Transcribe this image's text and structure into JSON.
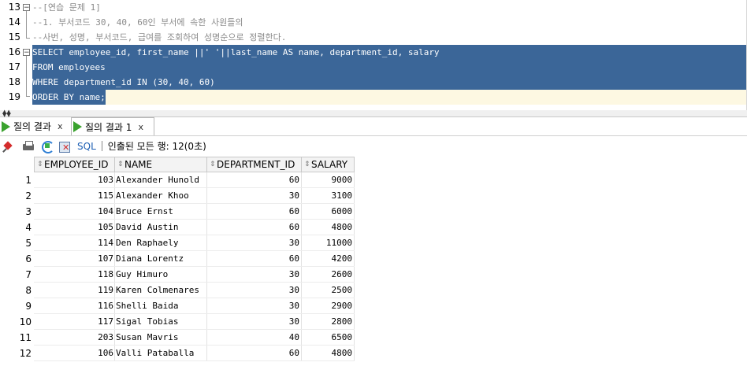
{
  "editor": {
    "lines": [
      {
        "num": "13",
        "text": "--[연습 문제 1]",
        "type": "comment"
      },
      {
        "num": "14",
        "text": "--1. 부서코드 30, 40, 60인 부서에 속한 사원들의",
        "type": "comment"
      },
      {
        "num": "15",
        "text": "--사번, 성명, 부서코드, 급여를 조회하여 성명순으로 정렬한다.",
        "type": "comment"
      },
      {
        "num": "16",
        "text": "SELECT employee_id, first_name ||' '||last_name AS name, department_id, salary",
        "type": "selected"
      },
      {
        "num": "17",
        "text": "FROM employees",
        "type": "selected"
      },
      {
        "num": "18",
        "text": "WHERE department_id IN (30, 40, 60)",
        "type": "selected"
      },
      {
        "num": "19",
        "text": "ORDER BY name;",
        "type": "selected-current"
      }
    ]
  },
  "result_tabs": [
    {
      "label": "질의 결과",
      "close": "x",
      "active": false
    },
    {
      "label": "질의 결과 1",
      "close": "x",
      "active": true
    }
  ],
  "toolbar": {
    "icons": [
      "pin-icon",
      "print-icon",
      "refresh-icon",
      "export-icon"
    ],
    "sql_label": "SQL",
    "status": "인출된 모든 행: 12(0초)"
  },
  "grid": {
    "columns": [
      "EMPLOYEE_ID",
      "NAME",
      "DEPARTMENT_ID",
      "SALARY"
    ],
    "rows": [
      {
        "rn": "1",
        "employee_id": "103",
        "name": "Alexander Hunold",
        "department_id": "60",
        "salary": "9000"
      },
      {
        "rn": "2",
        "employee_id": "115",
        "name": "Alexander Khoo",
        "department_id": "30",
        "salary": "3100"
      },
      {
        "rn": "3",
        "employee_id": "104",
        "name": "Bruce Ernst",
        "department_id": "60",
        "salary": "6000"
      },
      {
        "rn": "4",
        "employee_id": "105",
        "name": "David Austin",
        "department_id": "60",
        "salary": "4800"
      },
      {
        "rn": "5",
        "employee_id": "114",
        "name": "Den Raphaely",
        "department_id": "30",
        "salary": "11000"
      },
      {
        "rn": "6",
        "employee_id": "107",
        "name": "Diana Lorentz",
        "department_id": "60",
        "salary": "4200"
      },
      {
        "rn": "7",
        "employee_id": "118",
        "name": "Guy Himuro",
        "department_id": "30",
        "salary": "2600"
      },
      {
        "rn": "8",
        "employee_id": "119",
        "name": "Karen Colmenares",
        "department_id": "30",
        "salary": "2500"
      },
      {
        "rn": "9",
        "employee_id": "116",
        "name": "Shelli Baida",
        "department_id": "30",
        "salary": "2900"
      },
      {
        "rn": "10",
        "employee_id": "117",
        "name": "Sigal Tobias",
        "department_id": "30",
        "salary": "2800"
      },
      {
        "rn": "11",
        "employee_id": "203",
        "name": "Susan Mavris",
        "department_id": "40",
        "salary": "6500"
      },
      {
        "rn": "12",
        "employee_id": "106",
        "name": "Valli Pataballa",
        "department_id": "60",
        "salary": "4800"
      }
    ]
  },
  "colors": {
    "selection": "#3b6698",
    "current_line": "#fdf8e2",
    "comment": "#8a8a8a",
    "run_icon": "#3aa22e"
  }
}
